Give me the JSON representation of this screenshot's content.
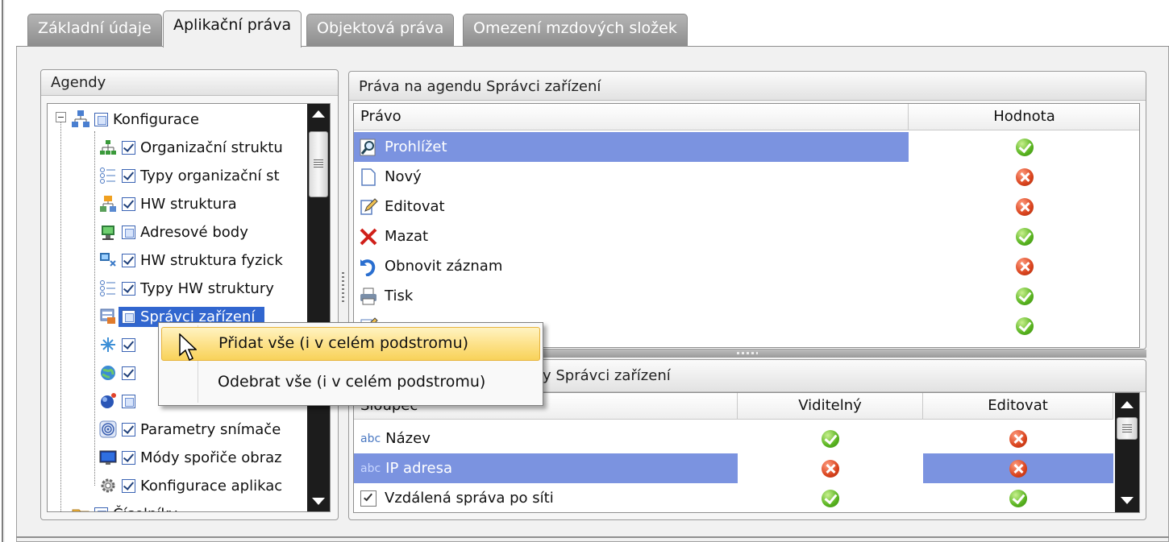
{
  "tabs": [
    {
      "label": "Základní údaje",
      "active": false
    },
    {
      "label": "Aplikační práva",
      "active": true
    },
    {
      "label": "Objektová práva",
      "active": false
    },
    {
      "label": "Omezení mzdových složek",
      "active": false
    }
  ],
  "agendas": {
    "title": "Agendy",
    "tree": [
      {
        "label": "Konfigurace",
        "checkbox": "partial",
        "icon": "network-icon",
        "level": 0
      },
      {
        "label": "Organizační struktu",
        "checkbox": "checked",
        "icon": "org-structure-icon",
        "level": 1
      },
      {
        "label": "Typy organizační st",
        "checkbox": "checked",
        "icon": "list-types-icon",
        "level": 1
      },
      {
        "label": "HW struktura",
        "checkbox": "checked",
        "icon": "hw-structure-icon",
        "level": 1
      },
      {
        "label": "Adresové body",
        "checkbox": "partial",
        "icon": "address-point-icon",
        "level": 1
      },
      {
        "label": "HW struktura fyzick",
        "checkbox": "checked",
        "icon": "hw-physical-icon",
        "level": 1
      },
      {
        "label": "Typy HW struktury",
        "checkbox": "checked",
        "icon": "list-types-icon",
        "level": 1
      },
      {
        "label": "Správci zařízení",
        "checkbox": "partial",
        "icon": "device-manager-icon",
        "level": 1,
        "selected": true
      },
      {
        "label": "",
        "checkbox": "checked",
        "icon": "connector-icon",
        "level": 1
      },
      {
        "label": "",
        "checkbox": "checked",
        "icon": "globe-icon",
        "level": 1
      },
      {
        "label": "",
        "checkbox": "partial",
        "icon": "ball-icon",
        "level": 1
      },
      {
        "label": "Parametry snímače",
        "checkbox": "checked",
        "icon": "fingerprint-icon",
        "level": 1
      },
      {
        "label": "Módy spořiče obraz",
        "checkbox": "checked",
        "icon": "screen-icon",
        "level": 1
      },
      {
        "label": "Konfigurace aplikac",
        "checkbox": "checked",
        "icon": "gear-icon",
        "level": 1
      },
      {
        "label": "Číselníky",
        "checkbox": "partial",
        "icon": "folder-icon",
        "level": 0
      }
    ]
  },
  "rights": {
    "title": "Práva na agendu Správci zařízení",
    "col_right": "Právo",
    "col_value": "Hodnota",
    "rows": [
      {
        "label": "Prohlížet",
        "icon": "magnifier-icon",
        "value": "ok",
        "selected": true
      },
      {
        "label": "Nový",
        "icon": "new-document-icon",
        "value": "no"
      },
      {
        "label": "Editovat",
        "icon": "edit-icon",
        "value": "no"
      },
      {
        "label": "Mazat",
        "icon": "delete-icon",
        "value": "ok"
      },
      {
        "label": "Obnovit záznam",
        "icon": "restore-icon",
        "value": "no"
      },
      {
        "label": "Tisk",
        "icon": "printer-icon",
        "value": "ok"
      },
      {
        "label": "",
        "icon": "edit-multi-icon",
        "value": "ok"
      }
    ]
  },
  "columns": {
    "title_fragment": "y Správci zařízení",
    "col_column": "Sloupec",
    "col_visible": "Viditelný",
    "col_edit": "Editovat",
    "rows": [
      {
        "prefix": "abc",
        "label": "Název",
        "visible": "ok",
        "edit": "no",
        "selected": false
      },
      {
        "prefix": "abc",
        "label": "IP adresa",
        "visible": "no",
        "edit": "no",
        "selected": true
      },
      {
        "prefix": "checkbox",
        "label": "Vzdálená správa po síti",
        "visible": "ok",
        "edit": "ok",
        "selected": false
      }
    ]
  },
  "context_menu": {
    "items": [
      {
        "label": "Přidat vše (i v celém podstromu)",
        "highlighted": true
      },
      {
        "label": "Odebrat vše (i v celém podstromu)",
        "highlighted": false
      }
    ]
  },
  "colors": {
    "selection": "#7b93e0",
    "tree_selection": "#3166cf",
    "menu_highlight": "#fde28a",
    "ok": "#58b31f",
    "no": "#d9431d"
  }
}
